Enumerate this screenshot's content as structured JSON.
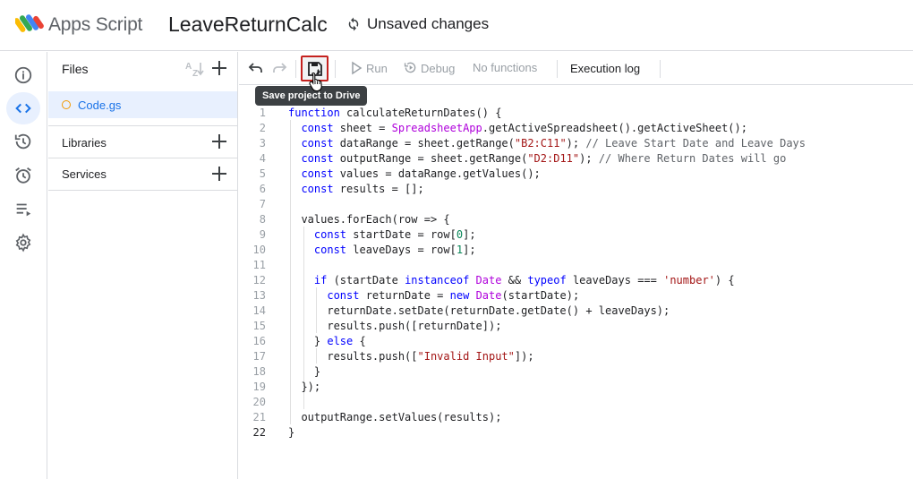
{
  "header": {
    "app_name": "Apps Script",
    "project_name": "LeaveReturnCalc",
    "status": "Unsaved changes"
  },
  "rail": {
    "items": [
      "overview",
      "editor",
      "executions",
      "triggers",
      "runs",
      "settings"
    ],
    "active": "editor"
  },
  "panel": {
    "files_label": "Files",
    "file_name": "Code.gs",
    "libraries_label": "Libraries",
    "services_label": "Services"
  },
  "toolbar": {
    "run_label": "Run",
    "debug_label": "Debug",
    "functions_label": "No functions",
    "execution_log_label": "Execution log",
    "tooltip": "Save project to Drive"
  },
  "editor": {
    "current_line": 22,
    "lines": [
      "function calculateReturnDates() {",
      "  const sheet = SpreadsheetApp.getActiveSpreadsheet().getActiveSheet();",
      "  const dataRange = sheet.getRange(\"B2:C11\"); // Leave Start Date and Leave Days",
      "  const outputRange = sheet.getRange(\"D2:D11\"); // Where Return Dates will go",
      "  const values = dataRange.getValues();",
      "  const results = [];",
      "",
      "  values.forEach(row => {",
      "    const startDate = row[0];",
      "    const leaveDays = row[1];",
      "",
      "    if (startDate instanceof Date && typeof leaveDays === 'number') {",
      "      const returnDate = new Date(startDate);",
      "      returnDate.setDate(returnDate.getDate() + leaveDays);",
      "      results.push([returnDate]);",
      "    } else {",
      "      results.push([\"Invalid Input\"]);",
      "    }",
      "  });",
      "",
      "  outputRange.setValues(results);",
      "}"
    ]
  },
  "colors": {
    "accent": "#1a73e8",
    "active_bg": "#e8f0fe",
    "keyword": "#0000ff",
    "string": "#a31515",
    "comment": "#5f6368",
    "type": "#af00db",
    "number": "#098658",
    "highlight_border": "#c5221f"
  }
}
